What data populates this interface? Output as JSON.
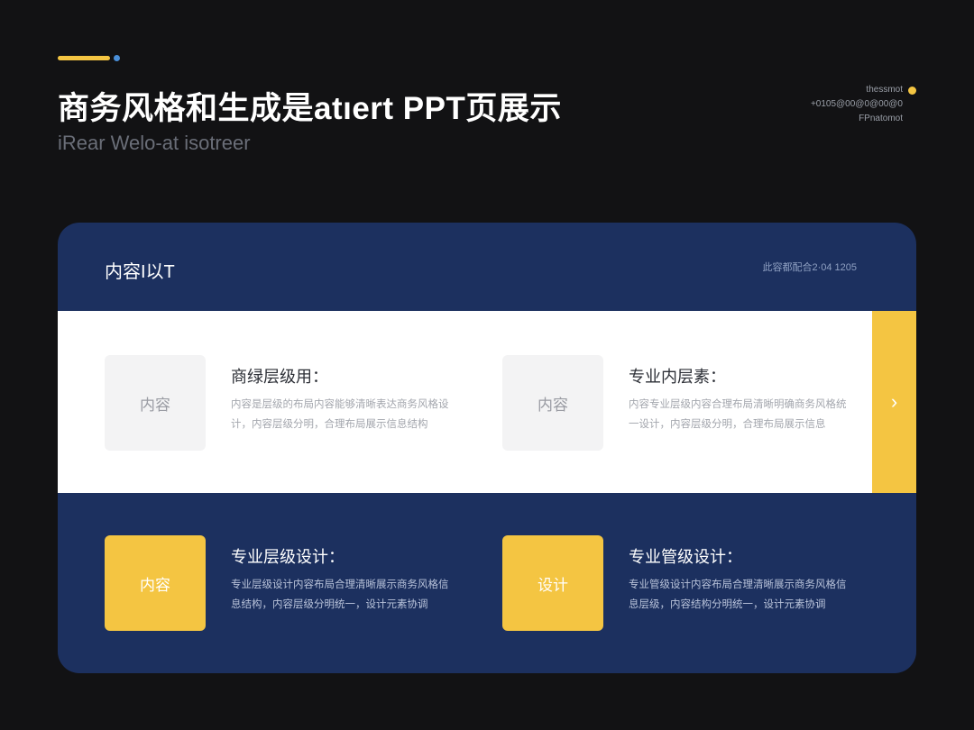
{
  "header": {
    "title": "商务风格和生成\u0000",
    "subtitle": "iRear Welo-at isotreer",
    "corner_line1": "thessmot",
    "corner_line2": "+0105@00@0@00@0",
    "corner_line3": "FPnatomot"
  },
  "panel": {
    "title": "内容I以T",
    "meta": "此容都配合2·04 1205",
    "next_glyph": "›",
    "cards": [
      {
        "thumb": "内容",
        "heading": "商绿层级用：",
        "desc": "内容是层级的布局内容能够清晰表达商务风格设计，内容层级分明，合理布局展示信息结构"
      },
      {
        "thumb": "内容",
        "heading": "专业内层素：",
        "desc": "内容专业层级内容合理布局清晰明确商务风格统一设计，内容层级分明，合理布局展示信息"
      },
      {
        "thumb": "内容",
        "heading": "专业层级设计：",
        "desc": "专业层级设计内容布局合理清晰展示商务风格信息结构，内容层级分明统一，设计元素协调"
      },
      {
        "thumb": "设计",
        "heading": "专业管级设计：",
        "desc": "专业管级设计内容布局合理清晰展示商务风格信息层级，内容结构分明统一，设计元素协调"
      }
    ]
  },
  "colors": {
    "background": "#121214",
    "panel": "#1c305f",
    "accent": "#f4c542",
    "dot": "#4a8fd9"
  }
}
